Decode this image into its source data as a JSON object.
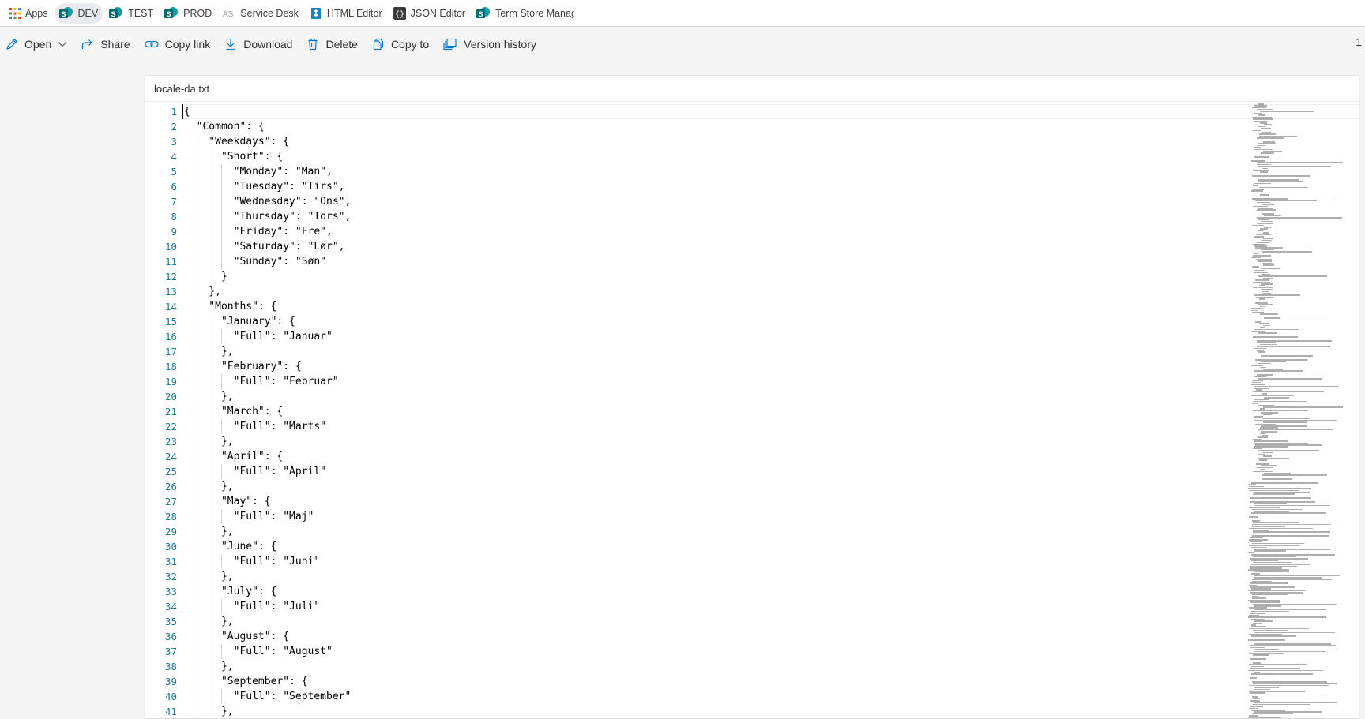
{
  "bookmarks": [
    {
      "label": "Apps",
      "icon": "apps-grid-icon",
      "active": false
    },
    {
      "label": "DEV",
      "icon": "sharepoint-icon",
      "active": true
    },
    {
      "label": "TEST",
      "icon": "sharepoint-icon",
      "active": false
    },
    {
      "label": "PROD",
      "icon": "sharepoint-icon",
      "active": false
    },
    {
      "label": "Service Desk",
      "icon": "service-desk-icon",
      "active": false
    },
    {
      "label": "HTML Editor",
      "icon": "sharepoint-icon",
      "active": false
    },
    {
      "label": "JSON Editor",
      "icon": "json-icon",
      "active": false
    },
    {
      "label": "Term Store Managem",
      "icon": "sharepoint-icon",
      "active": false
    }
  ],
  "commands": [
    {
      "label": "Open",
      "icon": "pencil-icon",
      "dropdown": true
    },
    {
      "label": "Share",
      "icon": "share-icon"
    },
    {
      "label": "Copy link",
      "icon": "link-icon"
    },
    {
      "label": "Download",
      "icon": "download-icon"
    },
    {
      "label": "Delete",
      "icon": "trash-icon"
    },
    {
      "label": "Copy to",
      "icon": "copy-icon"
    },
    {
      "label": "Version history",
      "icon": "version-history-icon"
    }
  ],
  "command_bar_right": "1",
  "file": {
    "name": "locale-da.txt"
  },
  "colors": {
    "line_number": "#237893",
    "accent": "#0078d4",
    "sharepoint": "#036c70"
  },
  "editor": {
    "current_line": 1,
    "lines": [
      {
        "n": "1",
        "text": "{"
      },
      {
        "n": "2",
        "text": "  \"Common\": {"
      },
      {
        "n": "3",
        "text": "    \"Weekdays\": {"
      },
      {
        "n": "4",
        "text": "      \"Short\": {"
      },
      {
        "n": "5",
        "text": "        \"Monday\": \"Man\","
      },
      {
        "n": "6",
        "text": "        \"Tuesday\": \"Tirs\","
      },
      {
        "n": "7",
        "text": "        \"Wednesday\": \"Ons\","
      },
      {
        "n": "8",
        "text": "        \"Thursday\": \"Tors\","
      },
      {
        "n": "9",
        "text": "        \"Friday\": \"Fre\","
      },
      {
        "n": "10",
        "text": "        \"Saturday\": \"Lør\","
      },
      {
        "n": "11",
        "text": "        \"Sunday\": \"Søn\""
      },
      {
        "n": "12",
        "text": "      }"
      },
      {
        "n": "13",
        "text": "    },"
      },
      {
        "n": "14",
        "text": "    \"Months\": {"
      },
      {
        "n": "15",
        "text": "      \"January\": {"
      },
      {
        "n": "16",
        "text": "        \"Full\": \"Januar\""
      },
      {
        "n": "17",
        "text": "      },"
      },
      {
        "n": "18",
        "text": "      \"February\": {"
      },
      {
        "n": "19",
        "text": "        \"Full\": \"Februar\""
      },
      {
        "n": "20",
        "text": "      },"
      },
      {
        "n": "21",
        "text": "      \"March\": {"
      },
      {
        "n": "22",
        "text": "        \"Full\": \"Marts\""
      },
      {
        "n": "23",
        "text": "      },"
      },
      {
        "n": "24",
        "text": "      \"April\": {"
      },
      {
        "n": "25",
        "text": "        \"Full\": \"April\""
      },
      {
        "n": "26",
        "text": "      },"
      },
      {
        "n": "27",
        "text": "      \"May\": {"
      },
      {
        "n": "28",
        "text": "        \"Full\": \"Maj\""
      },
      {
        "n": "29",
        "text": "      },"
      },
      {
        "n": "30",
        "text": "      \"June\": {"
      },
      {
        "n": "31",
        "text": "        \"Full\": \"Juni\""
      },
      {
        "n": "32",
        "text": "      },"
      },
      {
        "n": "33",
        "text": "      \"July\": {"
      },
      {
        "n": "34",
        "text": "        \"Full\": \"Juli\""
      },
      {
        "n": "35",
        "text": "      },"
      },
      {
        "n": "36",
        "text": "      \"August\": {"
      },
      {
        "n": "37",
        "text": "        \"Full\": \"August\""
      },
      {
        "n": "38",
        "text": "      },"
      },
      {
        "n": "39",
        "text": "      \"September\": {"
      },
      {
        "n": "40",
        "text": "        \"Full\": \"September\""
      },
      {
        "n": "41",
        "text": "      },"
      }
    ]
  }
}
